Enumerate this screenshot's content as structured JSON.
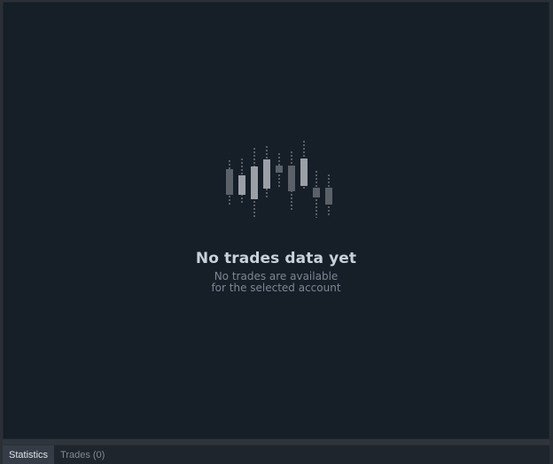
{
  "empty_state": {
    "icon": "candlestick-chart-icon",
    "title": "No trades data yet",
    "description_line1": "No trades are available",
    "description_line2": "for the selected account"
  },
  "tabs": [
    {
      "label": "Statistics",
      "active": true
    },
    {
      "label": "Trades (0)",
      "active": false
    }
  ],
  "colors": {
    "panel_background": "#161e28",
    "window_background": "#2b3036",
    "title_text": "#c8d1da",
    "muted_text": "#7c8793",
    "candle_light": "#9aa0a6",
    "candle_dark": "#5b6168"
  }
}
